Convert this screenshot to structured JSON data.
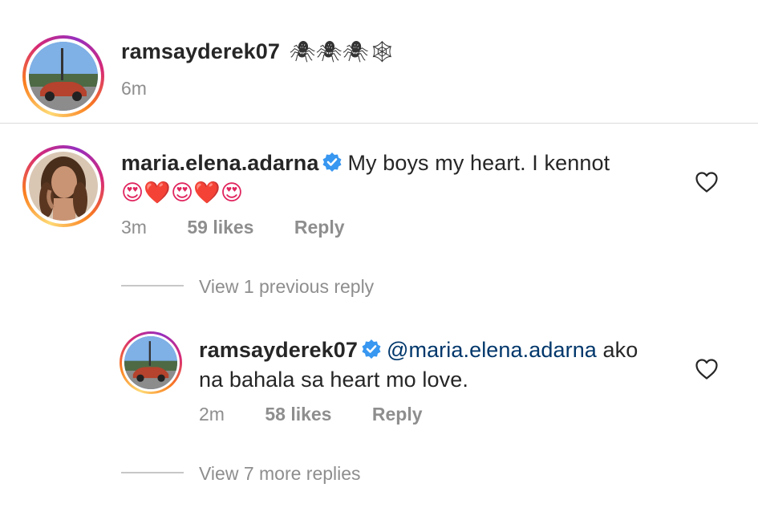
{
  "caption": {
    "username": "ramsayderek07",
    "emojis": "🕷🕷🕷🕸",
    "time": "6m"
  },
  "comment": {
    "username": "maria.elena.adarna",
    "text_line1": "My boys my heart. I kennot",
    "text_line2": "😍❤️😍❤️😍",
    "time": "3m",
    "likes": "59 likes",
    "reply_label": "Reply",
    "view_previous": "View 1 previous reply"
  },
  "reply": {
    "username": "ramsayderek07",
    "mention": "@maria.elena.adarna",
    "text_line1_rest": " ako",
    "text_line2": "na bahala sa heart mo love.",
    "time": "2m",
    "likes": "58 likes",
    "reply_label": "Reply",
    "view_more": "View 7 more replies"
  },
  "colors": {
    "verified_blue": "#3897f0",
    "mention": "#00376b",
    "meta_gray": "#8e8e8e"
  },
  "icons": {
    "verified": "verified-badge-icon",
    "heart": "heart-outline-icon"
  }
}
